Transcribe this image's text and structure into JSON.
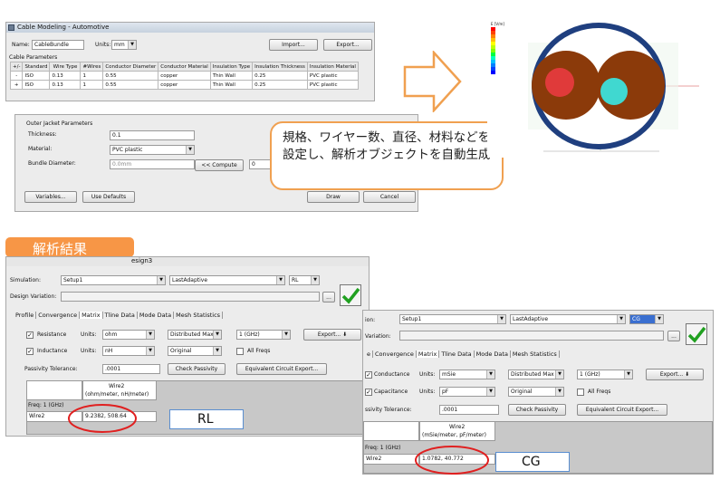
{
  "cable_window": {
    "title": "Cable Modeling - Automotive",
    "name_label": "Name:",
    "name_value": "CableBundle",
    "units_label": "Units:",
    "units_value": "mm",
    "import_label": "Import...",
    "export_label": "Export...",
    "section_label": "Cable Parameters",
    "columns": [
      "+/-",
      "Standard",
      "Wire Type",
      "#Wires",
      "Conductor Diameter",
      "Conductor Material",
      "Insulation Type",
      "Insulation Thickness",
      "Insulation Material"
    ],
    "rows": [
      {
        "sign": "-",
        "standard": "ISO",
        "wire_type": "0.13",
        "wires": "1",
        "cond_diam": "0.55",
        "cond_mat": "copper",
        "ins_type": "Thin Wall",
        "ins_thick": "0.25",
        "ins_mat": "PVC plastic"
      },
      {
        "sign": "+",
        "standard": "ISO",
        "wire_type": "0.13",
        "wires": "1",
        "cond_diam": "0.55",
        "cond_mat": "copper",
        "ins_type": "Thin Wall",
        "ins_thick": "0.25",
        "ins_mat": "PVC plastic"
      }
    ]
  },
  "jacket": {
    "section_label": "Outer Jacket Parameters",
    "thickness_label": "Thickness:",
    "thickness_value": "0.1",
    "material_label": "Material:",
    "material_value": "PVC plastic",
    "bundle_label": "Bundle Diameter:",
    "bundle_value": "0.0mm",
    "compute_label": "<< Compute",
    "extra_value": "0",
    "variables_label": "Variables...",
    "defaults_label": "Use Defaults",
    "draw_label": "Draw",
    "cancel_label": "Cancel"
  },
  "callout": {
    "text": "規格、ワイヤー数、直径、材料などを設定し、解析オブジェクトを自動生成"
  },
  "results_label": "解析結果",
  "rl_window": {
    "title_fragment": "esign3",
    "simulation_label": "Simulation:",
    "simulation_value": "Setup1",
    "solution_value": "LastAdaptive",
    "matrix_value": "RL",
    "variation_label": "Design Variation:",
    "more_label": "...",
    "tabs": [
      "Profile",
      "Convergence",
      "Matrix",
      "Tline Data",
      "Mode Data",
      "Mesh Statistics"
    ],
    "row1_label": "Resistance",
    "row1_units": "ohm",
    "row1_mode": "Distributed Max",
    "row1_freq": "1 (GHz)",
    "export_label": "Export...",
    "row2_label": "Inductance",
    "row2_units": "nH",
    "row2_mode": "Original",
    "all_freqs": "All Freqs",
    "units_label": "Units:",
    "passivity_label": "Passivity Tolerance:",
    "passivity_value": ".0001",
    "check_label": "Check Passivity",
    "equiv_label": "Equivalent Circuit Export...",
    "col_head": "Wire2",
    "col_unit": "(ohm/meter, nH/meter)",
    "freq_label": "Freq: 1 (GHz)",
    "row_head": "Wire2",
    "value": "9.2382, 508.64",
    "tag": "RL"
  },
  "cg_window": {
    "simulation_label": "ion:",
    "simulation_value": "Setup1",
    "solution_value": "LastAdaptive",
    "matrix_value": "CG",
    "variation_label": "Variation:",
    "more_label": "...",
    "tabs": [
      "e",
      "Convergence",
      "Matrix",
      "Tline Data",
      "Mode Data",
      "Mesh Statistics"
    ],
    "row1_label": "Conductance",
    "row1_units": "mSie",
    "row1_mode": "Distributed Max",
    "row1_freq": "1 (GHz)",
    "export_label": "Export...",
    "row2_label": "Capacitance",
    "row2_units": "pF",
    "row2_mode": "Original",
    "all_freqs": "All Freqs",
    "units_label": "Units:",
    "passivity_label": "ssivity Tolerance:",
    "passivity_value": ".0001",
    "check_label": "Check Passivity",
    "equiv_label": "Equivalent Circuit Export...",
    "col_head": "Wire2",
    "col_unit": "(mSie/meter, pF/meter)",
    "freq_label": "Freq: 1 (GHz)",
    "row_head": "Wire2",
    "value": "1.0782, 40.772",
    "tag": "CG"
  },
  "field_plot": {
    "legend_title": "E [V/m]",
    "legend_colors": [
      "#ff0000",
      "#ff4000",
      "#ff8000",
      "#ffbf00",
      "#ffff00",
      "#bfff00",
      "#80ff00",
      "#00ff40",
      "#00ffbf",
      "#00bfff",
      "#0080ff",
      "#0040ff",
      "#0000ff"
    ]
  },
  "colors": {
    "callout_border": "#f0a050",
    "results_badge": "#f79646",
    "highlight_ellipse": "#e02020",
    "cable_ring": "#1f3f7f",
    "insulation": "#8b3a0a"
  }
}
